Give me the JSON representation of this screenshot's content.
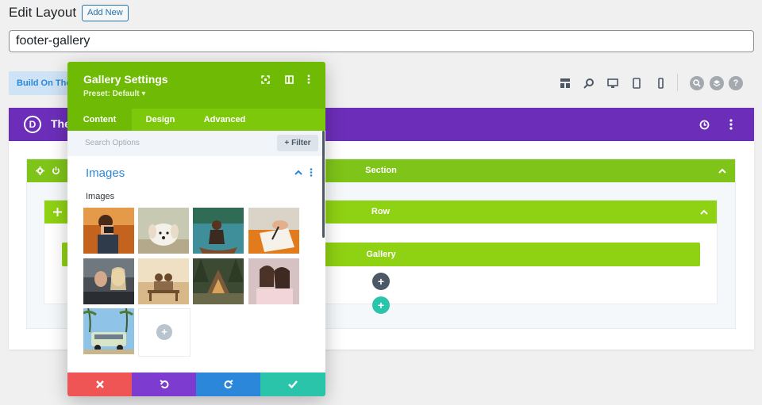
{
  "header": {
    "title": "Edit Layout",
    "add_new_label": "Add New",
    "layout_title_value": "footer-gallery"
  },
  "build_bar": {
    "build_button_label": "Build On The",
    "view_icons": [
      "wireframe-view-icon",
      "zoom-icon",
      "desktop-view-icon",
      "tablet-view-icon",
      "phone-view-icon"
    ],
    "round_icons": [
      "search-icon",
      "layers-icon",
      "help-icon"
    ],
    "help_glyph": "?"
  },
  "builder": {
    "logo_letter": "D",
    "layout_name": "The",
    "section_label": "Section",
    "row_label": "Row",
    "module_label": "Gallery",
    "colors": {
      "purple": "#6c2eb9",
      "section_green": "#7fc418",
      "row_green": "#8fd113",
      "teal": "#29c4a9"
    }
  },
  "modal": {
    "title": "Gallery Settings",
    "preset": "Preset: Default ▾",
    "tabs": [
      {
        "label": "Content",
        "active": true
      },
      {
        "label": "Design",
        "active": false
      },
      {
        "label": "Advanced",
        "active": false
      }
    ],
    "search_placeholder": "Search Options",
    "filter_label": "+ Filter",
    "group_title": "Images",
    "field_label": "Images",
    "images": [
      "woman-with-camera",
      "white-puppy",
      "woman-in-canoe",
      "hand-writing-notebook",
      "two-women-in-car",
      "couple-on-bench",
      "cabin-in-forest",
      "two-women-selfie",
      "vintage-van-with-palms"
    ],
    "footer": {
      "cancel_color": "#ef5555",
      "undo_color": "#7e3bd0",
      "redo_color": "#2b87da",
      "save_color": "#29c4a9"
    }
  }
}
